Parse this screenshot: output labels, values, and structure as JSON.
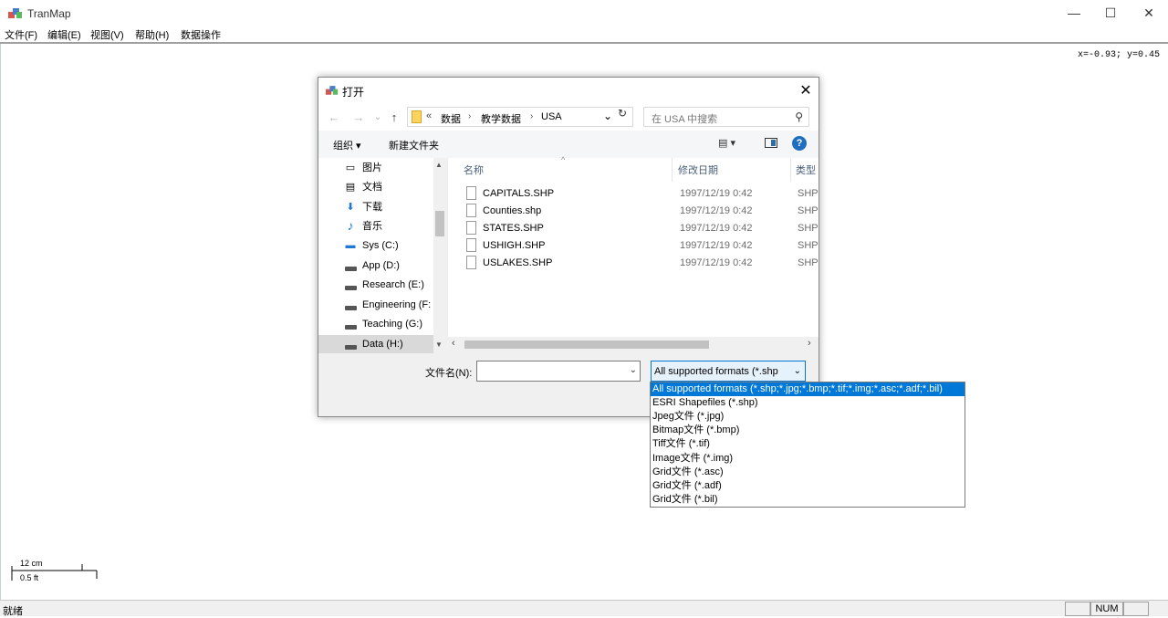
{
  "app": {
    "title": "TranMap"
  },
  "window_controls": {
    "minimize": "—",
    "maximize": "☐",
    "close": "✕"
  },
  "menu": [
    "文件(F)",
    "编辑(E)",
    "视图(V)",
    "帮助(H)",
    "数据操作"
  ],
  "canvas": {
    "coord_readout": "x=-0.93; y=0.45"
  },
  "scalebar": {
    "top_label": "12 cm",
    "bottom_label": "0.5 ft"
  },
  "status": {
    "text": "就绪",
    "num": "NUM"
  },
  "dialog": {
    "title": "打开",
    "close": "✕",
    "nav": {
      "back": "←",
      "forward": "→",
      "recent": "⌄",
      "up": "↑"
    },
    "address": {
      "overflow": "«",
      "crumbs": [
        "数据",
        "教学数据",
        "USA"
      ],
      "sep": "›",
      "dropdown": "⌄",
      "refresh": "↻"
    },
    "search": {
      "placeholder": "在 USA 中搜索",
      "icon": "⚲"
    },
    "toolbar": {
      "organize": "组织 ▾",
      "new_folder": "新建文件夹",
      "view": "▤ ▾",
      "help": "?"
    },
    "nav_pane": {
      "items": [
        {
          "label": "图片",
          "icon": "pictures-icon",
          "glyph": "▭"
        },
        {
          "label": "文档",
          "icon": "documents-icon",
          "glyph": "▤"
        },
        {
          "label": "下载",
          "icon": "downloads-icon",
          "glyph": "⬇"
        },
        {
          "label": "音乐",
          "icon": "music-icon",
          "glyph": "♪"
        },
        {
          "label": "Sys (C:)",
          "icon": "system-drive-icon",
          "glyph": "▬"
        },
        {
          "label": "App (D:)",
          "icon": "drive-icon",
          "glyph": ""
        },
        {
          "label": "Research (E:)",
          "icon": "drive-icon",
          "glyph": ""
        },
        {
          "label": "Engineering (F:",
          "icon": "drive-icon",
          "glyph": ""
        },
        {
          "label": "Teaching (G:)",
          "icon": "drive-icon",
          "glyph": ""
        },
        {
          "label": "Data (H:)",
          "icon": "drive-icon",
          "glyph": ""
        }
      ],
      "selected": "Data (H:)"
    },
    "columns": {
      "name": "名称",
      "modified": "修改日期",
      "type": "类型"
    },
    "files": [
      {
        "name": "CAPITALS.SHP",
        "modified": "1997/12/19 0:42",
        "type": "SHP"
      },
      {
        "name": "Counties.shp",
        "modified": "1997/12/19 0:42",
        "type": "SHP"
      },
      {
        "name": "STATES.SHP",
        "modified": "1997/12/19 0:42",
        "type": "SHP"
      },
      {
        "name": "USHIGH.SHP",
        "modified": "1997/12/19 0:42",
        "type": "SHP"
      },
      {
        "name": "USLAKES.SHP",
        "modified": "1997/12/19 0:42",
        "type": "SHP"
      }
    ],
    "filename_label": "文件名(N):",
    "filename_value": "",
    "filter": {
      "selected": "All supported formats (*.shp",
      "options": [
        "All supported formats (*.shp;*.jpg;*.bmp;*.tif;*.img;*.asc;*.adf;*.bil)",
        "ESRI Shapefiles (*.shp)",
        "Jpeg文件 (*.jpg)",
        "Bitmap文件 (*.bmp)",
        "Tiff文件 (*.tif)",
        "Image文件 (*.img)",
        "Grid文件 (*.asc)",
        "Grid文件 (*.adf)",
        "Grid文件 (*.bil)"
      ]
    }
  },
  "colors": {
    "accent": "#0078d7",
    "help": "#1e6fc0",
    "folder": "#ffd35b"
  }
}
